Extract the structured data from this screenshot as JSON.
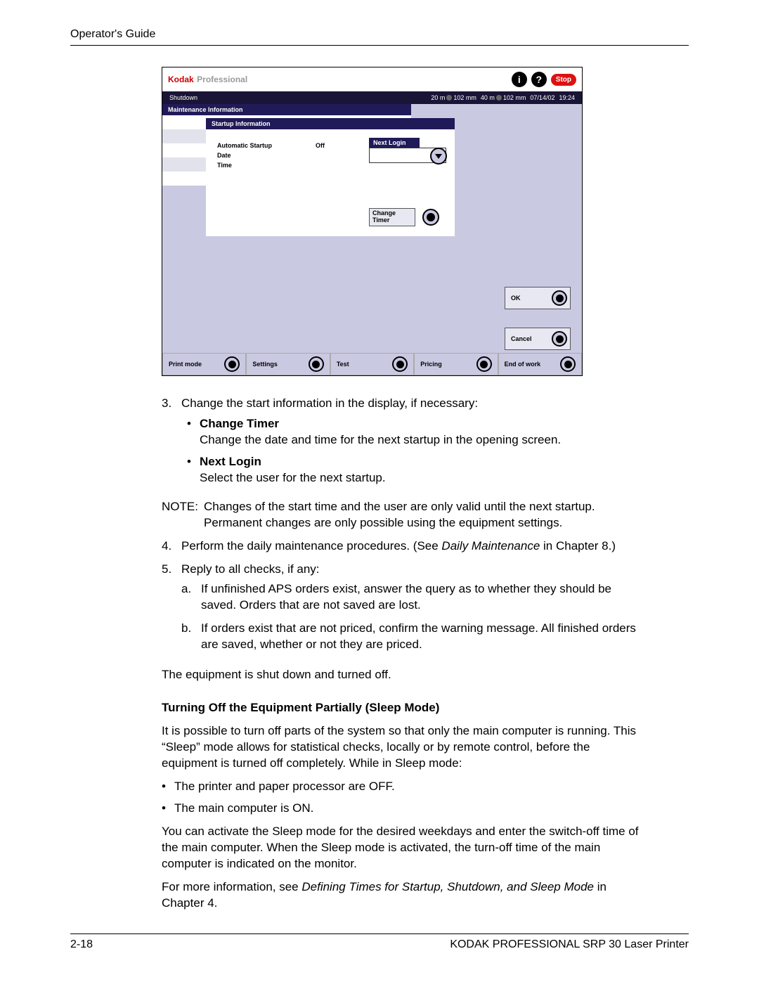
{
  "header": {
    "title": "Operator's Guide"
  },
  "screenshot": {
    "brand_kodak": "Kodak",
    "brand_pro": "Professional",
    "stop": "Stop",
    "darkbar_left": "Shutdown",
    "status1a": "20 m",
    "status1b": "102 mm",
    "status2a": "40 m",
    "status2b": "102 mm",
    "date": "07/14/02",
    "time": "19:24",
    "startup_header": "Startup Information",
    "auto_startup": "Automatic Startup",
    "auto_startup_val": "Off",
    "date_label": "Date",
    "time_label": "Time",
    "next_login": "Next Login",
    "change_timer": "Change Timer",
    "maint_header": "Maintenance Information",
    "ok": "OK",
    "cancel": "Cancel",
    "bottom": {
      "print_mode": "Print mode",
      "settings": "Settings",
      "test": "Test",
      "pricing": "Pricing",
      "end_of_work": "End of work"
    }
  },
  "step3": "Change the start information in the display, if necessary:",
  "bullet_ct": "Change Timer",
  "bullet_ct_text": "Change the date and time for the next startup in the opening screen.",
  "bullet_nl": "Next Login",
  "bullet_nl_text": "Select the user for the next startup.",
  "note_label": "NOTE:",
  "note_text": "Changes of the start time and the user are only valid until the next startup. Permanent changes are only possible using the equipment settings.",
  "step4a": "Perform the daily maintenance procedures. (See ",
  "step4b": "Daily Maintenance",
  "step4c": " in Chapter 8.)",
  "step5": "Reply to all checks, if any:",
  "step5a": "If unfinished APS orders exist, answer the query as to whether they should be saved. Orders that are not saved are lost.",
  "step5b": "If orders exist that are not priced, confirm the warning message. All finished orders are saved, whether or not they are priced.",
  "para_shutoff": "The equipment is shut down and turned off.",
  "heading_sleep": "Turning Off the Equipment Partially (Sleep Mode)",
  "sleep_p1": "It is possible to turn off parts of the system so that only the main computer is running. This “Sleep” mode allows for statistical checks, locally or by remote control, before the equipment is turned off completely. While in Sleep mode:",
  "sleep_b1": "The printer and paper processor are OFF.",
  "sleep_b2": "The main computer is ON.",
  "sleep_p2": "You can activate the Sleep mode for the desired weekdays and enter the switch-off time of the main computer. When the Sleep mode is activated, the turn-off time of the main computer is indicated on the monitor.",
  "sleep_p3a": "For more information, see ",
  "sleep_p3b": "Defining Times for Startup, Shutdown, and Sleep Mode",
  "sleep_p3c": " in Chapter 4.",
  "footer": {
    "page_num": "2-18",
    "product": "KODAK PROFESSIONAL SRP 30 Laser Printer"
  }
}
